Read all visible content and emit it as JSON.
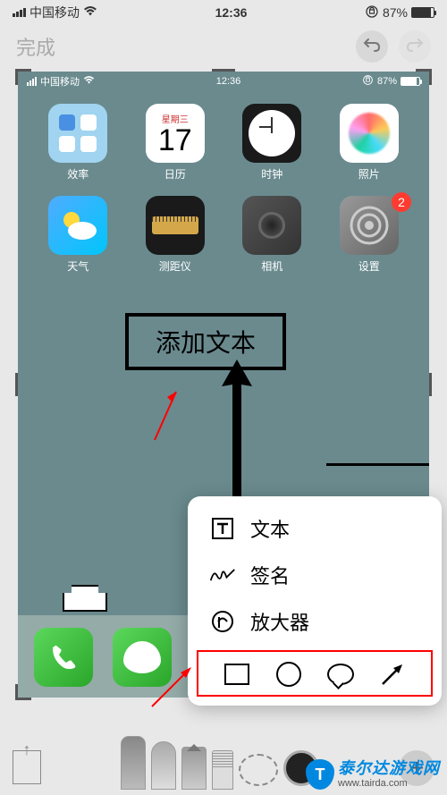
{
  "status_outer": {
    "carrier": "中国移动",
    "time": "12:36",
    "battery_pct": "87%"
  },
  "editor": {
    "done_label": "完成"
  },
  "status_inner": {
    "carrier": "中国移动",
    "time": "12:36",
    "battery_pct": "87%"
  },
  "calendar_tile": {
    "weekday": "星期三",
    "day": "17"
  },
  "apps": [
    {
      "label": "效率"
    },
    {
      "label": "日历"
    },
    {
      "label": "时钟"
    },
    {
      "label": "照片"
    },
    {
      "label": "天气"
    },
    {
      "label": "测距仪"
    },
    {
      "label": "相机"
    },
    {
      "label": "设置"
    }
  ],
  "settings_badge": "2",
  "annotation_box": "添加文本",
  "popup": {
    "text": "文本",
    "signature": "签名",
    "magnifier": "放大器"
  },
  "watermark": {
    "shield": "T",
    "brand": "泰尔达游戏网",
    "url": "www.tairda.com"
  }
}
